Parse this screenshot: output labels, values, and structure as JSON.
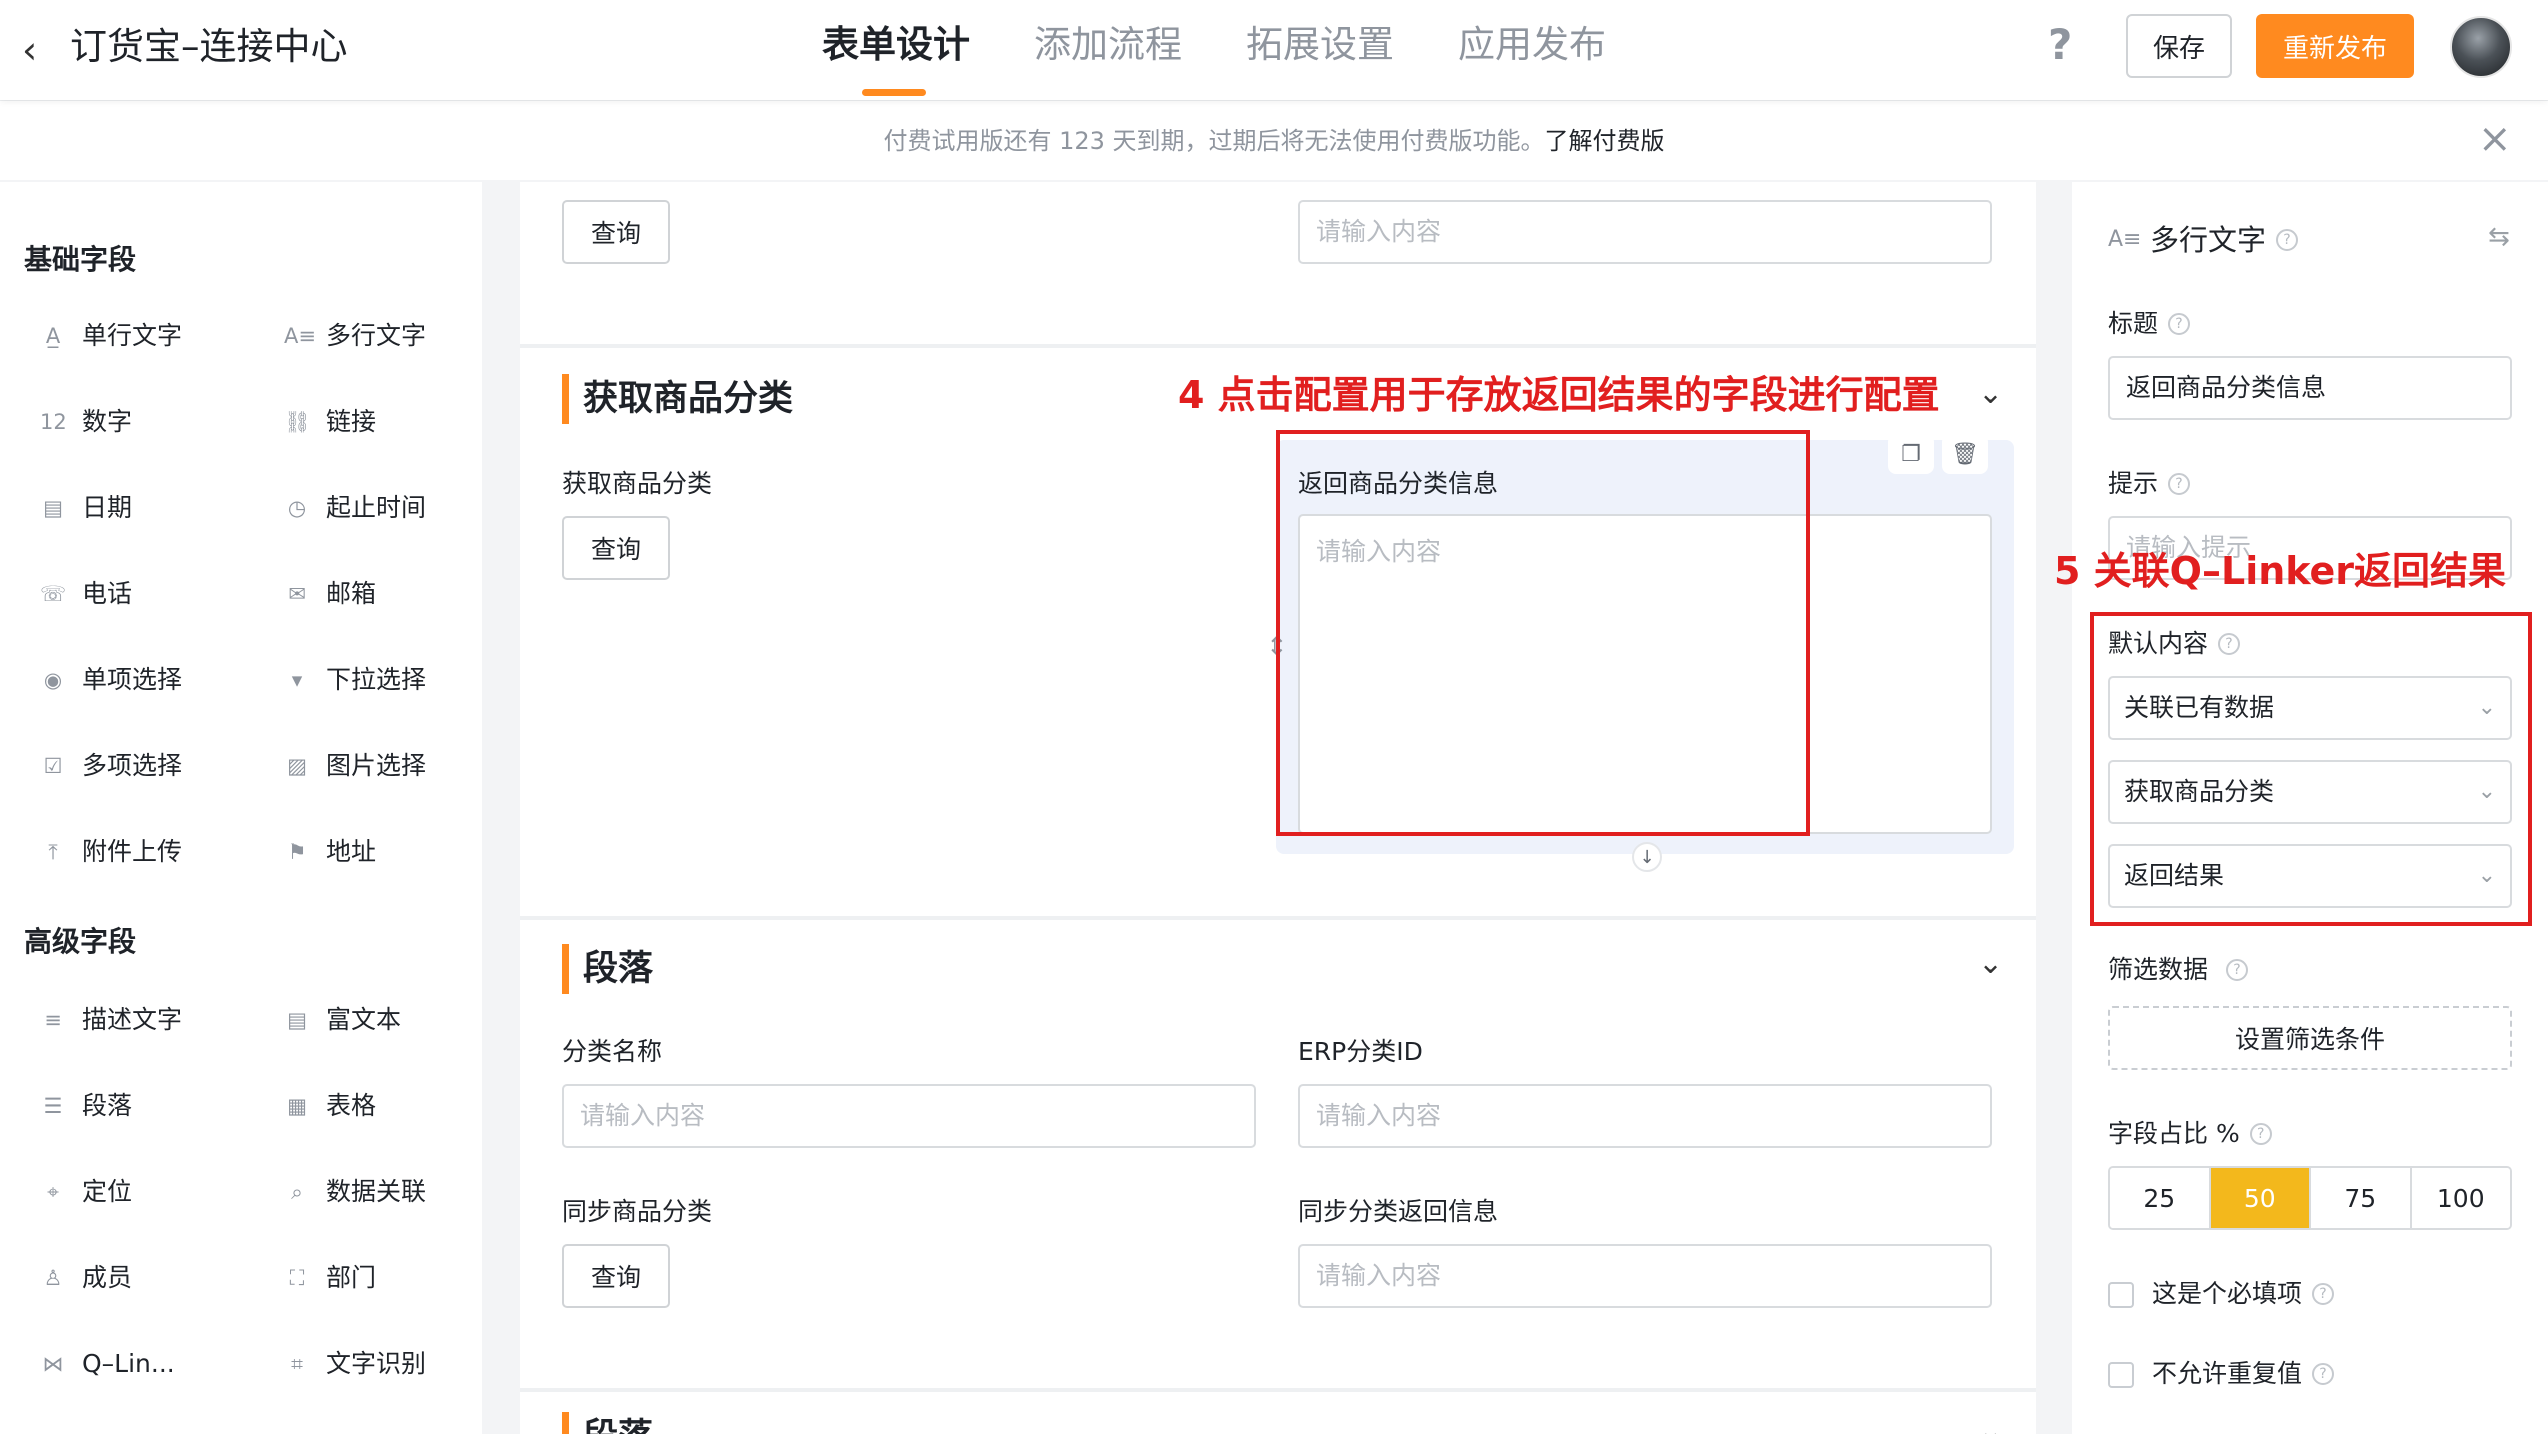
{
  "header": {
    "back_icon": "chevron-left-icon",
    "app_title": "订货宝–连接中心",
    "tabs": [
      {
        "label": "表单设计",
        "active": true
      },
      {
        "label": "添加流程",
        "active": false
      },
      {
        "label": "拓展设置",
        "active": false
      },
      {
        "label": "应用发布",
        "active": false
      }
    ],
    "help_icon": "?",
    "save_label": "保存",
    "publish_label": "重新发布",
    "accent_color": "#ff8a1f"
  },
  "banner": {
    "text": "付费试用版还有 123 天到期，过期后将无法使用付费版功能。",
    "link": "了解付费版",
    "close_icon": "×"
  },
  "left_panel": {
    "basic_title": "基础字段",
    "basic_items": [
      {
        "label": "单行文字",
        "icon": "A̲"
      },
      {
        "label": "多行文字",
        "icon": "A≡"
      },
      {
        "label": "数字",
        "icon": "12"
      },
      {
        "label": "链接",
        "icon": "⛓"
      },
      {
        "label": "日期",
        "icon": "▤"
      },
      {
        "label": "起止时间",
        "icon": "◷"
      },
      {
        "label": "电话",
        "icon": "☏"
      },
      {
        "label": "邮箱",
        "icon": "✉"
      },
      {
        "label": "单项选择",
        "icon": "◉"
      },
      {
        "label": "下拉选择",
        "icon": "▾"
      },
      {
        "label": "多项选择",
        "icon": "☑"
      },
      {
        "label": "图片选择",
        "icon": "▨"
      },
      {
        "label": "附件上传",
        "icon": "⤒"
      },
      {
        "label": "地址",
        "icon": "⚑"
      }
    ],
    "advanced_title": "高级字段",
    "advanced_items": [
      {
        "label": "描述文字",
        "icon": "≡"
      },
      {
        "label": "富文本",
        "icon": "▤"
      },
      {
        "label": "段落",
        "icon": "☰"
      },
      {
        "label": "表格",
        "icon": "▦"
      },
      {
        "label": "定位",
        "icon": "⌖"
      },
      {
        "label": "数据关联",
        "icon": "⌕"
      },
      {
        "label": "成员",
        "icon": "♙"
      },
      {
        "label": "部门",
        "icon": "⛶"
      },
      {
        "label": "Q–Lin...",
        "icon": "⋈"
      },
      {
        "label": "文字识别",
        "icon": "⌗"
      }
    ]
  },
  "canvas": {
    "top_query_label": "查询",
    "top_input_placeholder": "请输入内容",
    "section1": {
      "title": "获取商品分类",
      "field_label": "获取商品分类",
      "query_label": "查询",
      "selected_field_label": "返回商品分类信息",
      "selected_placeholder": "请输入内容"
    },
    "annotation4": "4 点击配置用于存放返回结果的字段进行配置",
    "section2": {
      "title": "段落",
      "fields": [
        {
          "label": "分类名称",
          "placeholder": "请输入内容"
        },
        {
          "label": "ERP分类ID",
          "placeholder": "请输入内容"
        },
        {
          "label": "同步商品分类",
          "button": "查询"
        },
        {
          "label": "同步分类返回信息",
          "placeholder": "请输入内容"
        }
      ]
    },
    "section3_title": "段落"
  },
  "right_panel": {
    "type_title": "多行文字",
    "title_label": "标题",
    "title_value": "返回商品分类信息",
    "hint_label": "提示",
    "hint_placeholder": "请输入提示",
    "annotation5": "5 关联Q–Linker返回结果",
    "default_label": "默认内容",
    "default_selects": [
      "关联已有数据",
      "获取商品分类",
      "返回结果"
    ],
    "filter_label": "筛选数据",
    "filter_button": "设置筛选条件",
    "ratio_label": "字段占比 %",
    "ratio_options": [
      "25",
      "50",
      "75",
      "100"
    ],
    "ratio_selected": "50",
    "required_label": "这是个必填项",
    "unique_label": "不允许重复值"
  }
}
